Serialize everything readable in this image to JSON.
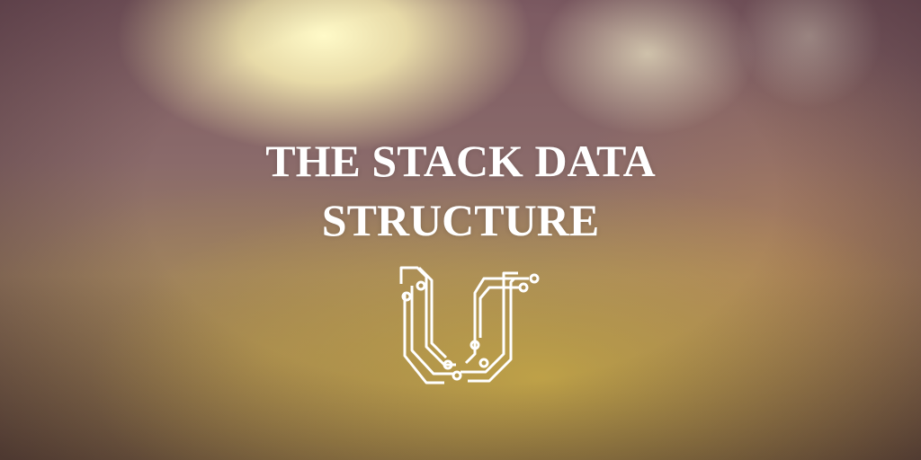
{
  "title_lines": [
    "THE STACK DATA",
    "STRUCTURE"
  ],
  "logo": {
    "icon": "circuit-u-logo",
    "color": "#ffffff"
  }
}
